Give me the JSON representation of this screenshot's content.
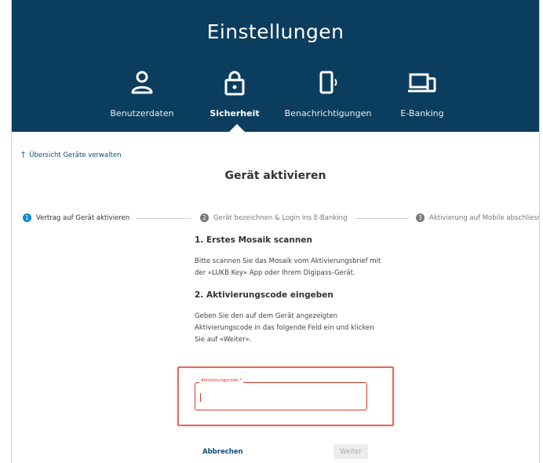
{
  "header": {
    "title": "Einstellungen",
    "background_color": "#0b3d5e",
    "nav": [
      {
        "label": "Benutzerdaten",
        "icon": "user-icon",
        "active": false
      },
      {
        "label": "Sicherheit",
        "icon": "lock-icon",
        "active": true
      },
      {
        "label": "Benachrichtigungen",
        "icon": "smartphone-notification-icon",
        "active": false
      },
      {
        "label": "E-Banking",
        "icon": "devices-icon",
        "active": false
      }
    ]
  },
  "back_link": {
    "label": "Übersicht Geräte verwalten",
    "icon": "arrow-up-icon"
  },
  "page_title": "Gerät aktivieren",
  "stepper": {
    "steps": [
      {
        "number": "1",
        "label": "Vertrag auf Gerät aktivieren",
        "state": "active"
      },
      {
        "number": "2",
        "label": "Gerät bezeichnen & Login ins E-Banking",
        "state": "inactive"
      },
      {
        "number": "3",
        "label": "Aktivierung auf Mobile abschliessen",
        "state": "inactive"
      }
    ],
    "active_color": "#1289c9"
  },
  "sections": {
    "scan_title": "1. Erstes Mosaik scannen",
    "scan_text": "Bitte scannen Sie das Mosaik vom Aktivierungsbrief mit der «LUKB Key» App oder Ihrem Digipass-Gerät.",
    "code_title": "2. Aktivierungscode eingeben",
    "code_text": "Geben Sie den auf dem Gerät angezeigten Aktivierungscode in das folgende Feld ein und klicken Sie auf «Weiter»."
  },
  "activation_input": {
    "label": "Aktivierungscode *",
    "value": "",
    "placeholder": "",
    "error_color": "#d43a2a"
  },
  "actions": {
    "cancel_label": "Abbrechen",
    "next_label": "Weiter"
  }
}
